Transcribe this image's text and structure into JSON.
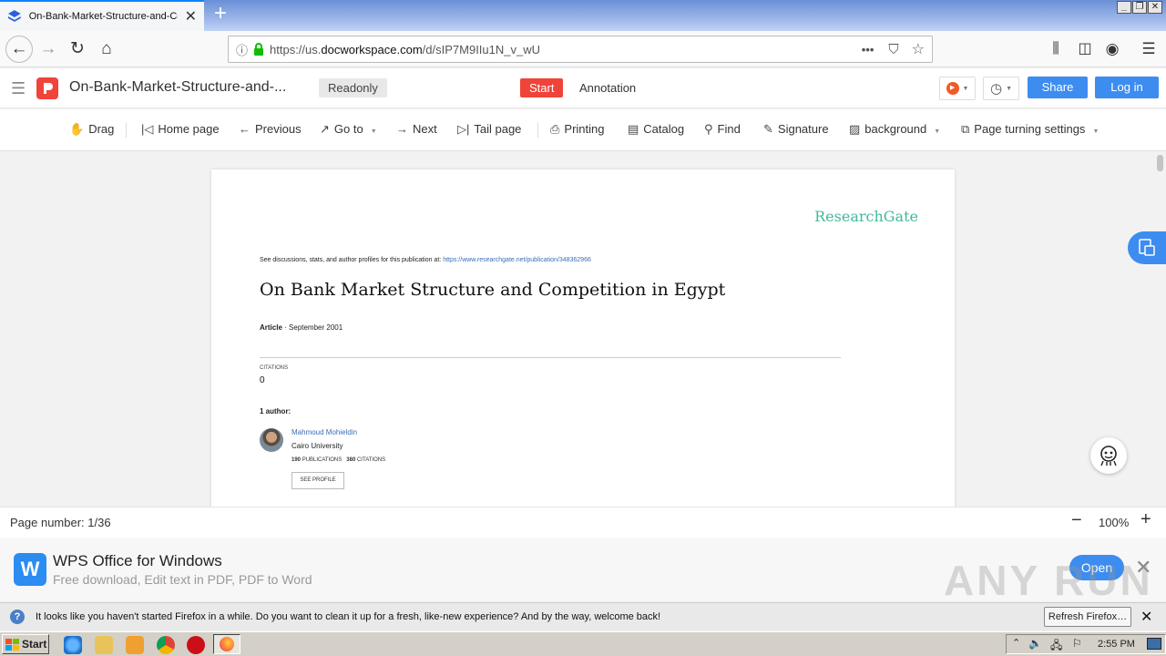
{
  "browser": {
    "tab_title": "On-Bank-Market-Structure-and-Co",
    "url_prefix": "https://us.",
    "url_domain": "docworkspace.com",
    "url_path": "/d/sIP7M9IIu1N_v_wU"
  },
  "app": {
    "doc_title": "On-Bank-Market-Structure-and-...",
    "readonly_badge": "Readonly",
    "start_button": "Start",
    "annotation_tab": "Annotation",
    "share_button": "Share",
    "login_button": "Log in"
  },
  "toolbar": {
    "drag": "Drag",
    "home": "Home page",
    "previous": "Previous",
    "goto": "Go to",
    "next": "Next",
    "tail": "Tail page",
    "printing": "Printing",
    "catalog": "Catalog",
    "find": "Find",
    "signature": "Signature",
    "background": "background",
    "page_turning": "Page turning settings"
  },
  "document": {
    "brand": "ResearchGate",
    "discussions_text": "See discussions, stats, and author profiles for this publication at:",
    "discussions_link": "https://www.researchgate.net/publication/348362966",
    "title": "On Bank Market Structure and Competition in Egypt",
    "article_label": "Article",
    "article_date": "· September 2001",
    "citations_label": "CITATIONS",
    "citations_value": "0",
    "authors_label": "1 author:",
    "author_name": "Mahmoud Mohieldin",
    "author_affiliation": "Cairo University",
    "publications_count": "190",
    "publications_label": "PUBLICATIONS",
    "author_citations_count": "380",
    "author_citations_label": "CITATIONS",
    "see_profile": "SEE PROFILE"
  },
  "status": {
    "page_number": "Page number: 1/36",
    "zoom": "100%"
  },
  "promo": {
    "title": "WPS Office for Windows",
    "subtitle": "Free download, Edit text in PDF, PDF to Word",
    "open_button": "Open"
  },
  "notification": {
    "message": "It looks like you haven't started Firefox in a while. Do you want to clean it up for a fresh, like-new experience? And by the way, welcome back!",
    "refresh_button": "Refresh Firefox…"
  },
  "taskbar": {
    "start_label": "Start",
    "clock": "2:55 PM"
  },
  "watermark": "ANY RUN",
  "colors": {
    "accent_blue": "#3d8cf0",
    "start_red": "#f0443a",
    "researchgate_teal": "#40ba9f",
    "link_blue": "#3a6db5"
  }
}
